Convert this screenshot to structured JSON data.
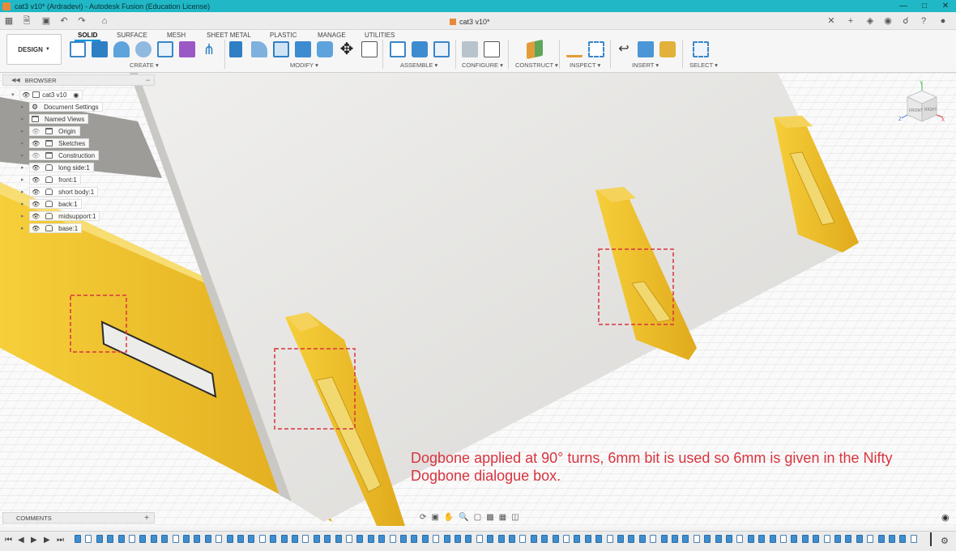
{
  "window": {
    "title": "cat3 v10* (Ardradevi) - Autodesk Fusion (Education License)",
    "controls": [
      "minimize-icon",
      "maximize-icon",
      "close-icon"
    ]
  },
  "doc_tab": {
    "label": "cat3 v10*"
  },
  "toolbar": {
    "workspace": "DESIGN",
    "tabs": [
      "SOLID",
      "SURFACE",
      "MESH",
      "SHEET METAL",
      "PLASTIC",
      "MANAGE",
      "UTILITIES"
    ],
    "active_tab": "SOLID",
    "groups": [
      "CREATE",
      "MODIFY",
      "ASSEMBLE",
      "CONFIGURE",
      "CONSTRUCT",
      "INSPECT",
      "INSERT",
      "SELECT"
    ]
  },
  "browser": {
    "title": "BROWSER",
    "root": "cat3 v10",
    "items": [
      "Document Settings",
      "Named Views",
      "Origin",
      "Sketches",
      "Construction",
      "long side:1",
      "front:1",
      "short body:1",
      "back:1",
      "midsupport:1",
      "base:1"
    ]
  },
  "viewcube": {
    "front": "FRONT",
    "right": "RIGHT",
    "x": "X",
    "y": "Y",
    "z": "Z"
  },
  "annotation": {
    "text": "Dogbone applied at 90° turns, 6mm bit is used so 6mm is given in the Nifty Dogbone dialogue box."
  },
  "comments": {
    "label": "COMMENTS"
  },
  "colors": {
    "titlebar": "#20b8c6",
    "accent": "#0696d7",
    "part_yellow": "#f0c030",
    "annotation_red": "#d8343f"
  }
}
